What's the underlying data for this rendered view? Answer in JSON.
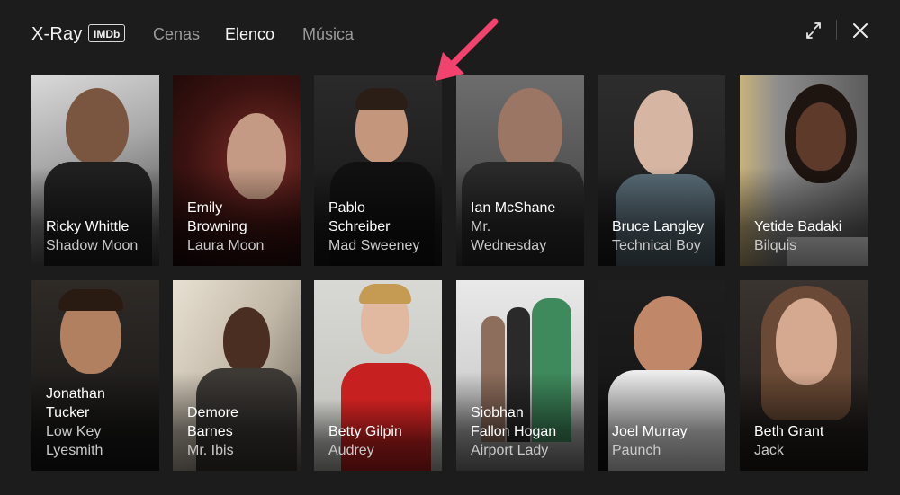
{
  "header": {
    "brand": "X-Ray",
    "badge": "IMDb",
    "tabs": [
      {
        "label": "Cenas",
        "active": false
      },
      {
        "label": "Elenco",
        "active": true
      },
      {
        "label": "Música",
        "active": false
      }
    ]
  },
  "cast": [
    {
      "name": "Ricky Whittle",
      "role": "Shadow Moon"
    },
    {
      "name": "Emily\nBrowning",
      "role": "Laura Moon"
    },
    {
      "name": "Pablo\nSchreiber",
      "role": "Mad Sweeney"
    },
    {
      "name": "Ian McShane",
      "role": "Mr.\nWednesday"
    },
    {
      "name": "Bruce Langley",
      "role": "Technical Boy"
    },
    {
      "name": "Yetide Badaki",
      "role": "Bilquis"
    },
    {
      "name": "Jonathan\nTucker",
      "role": "Low Key\nLyesmith"
    },
    {
      "name": "Demore\nBarnes",
      "role": "Mr. Ibis"
    },
    {
      "name": "Betty Gilpin",
      "role": "Audrey"
    },
    {
      "name": "Siobhan\nFallon Hogan",
      "role": "Airport Lady"
    },
    {
      "name": "Joel Murray",
      "role": "Paunch"
    },
    {
      "name": "Beth Grant",
      "role": "Jack"
    }
  ],
  "colors": {
    "background": "#1c1c1c",
    "active_tab": "#f5f5f5",
    "inactive_tab": "#9a9a9a",
    "annotation_arrow": "#f2436e"
  },
  "icons": {
    "expand": "expand-icon",
    "close": "close-icon"
  }
}
